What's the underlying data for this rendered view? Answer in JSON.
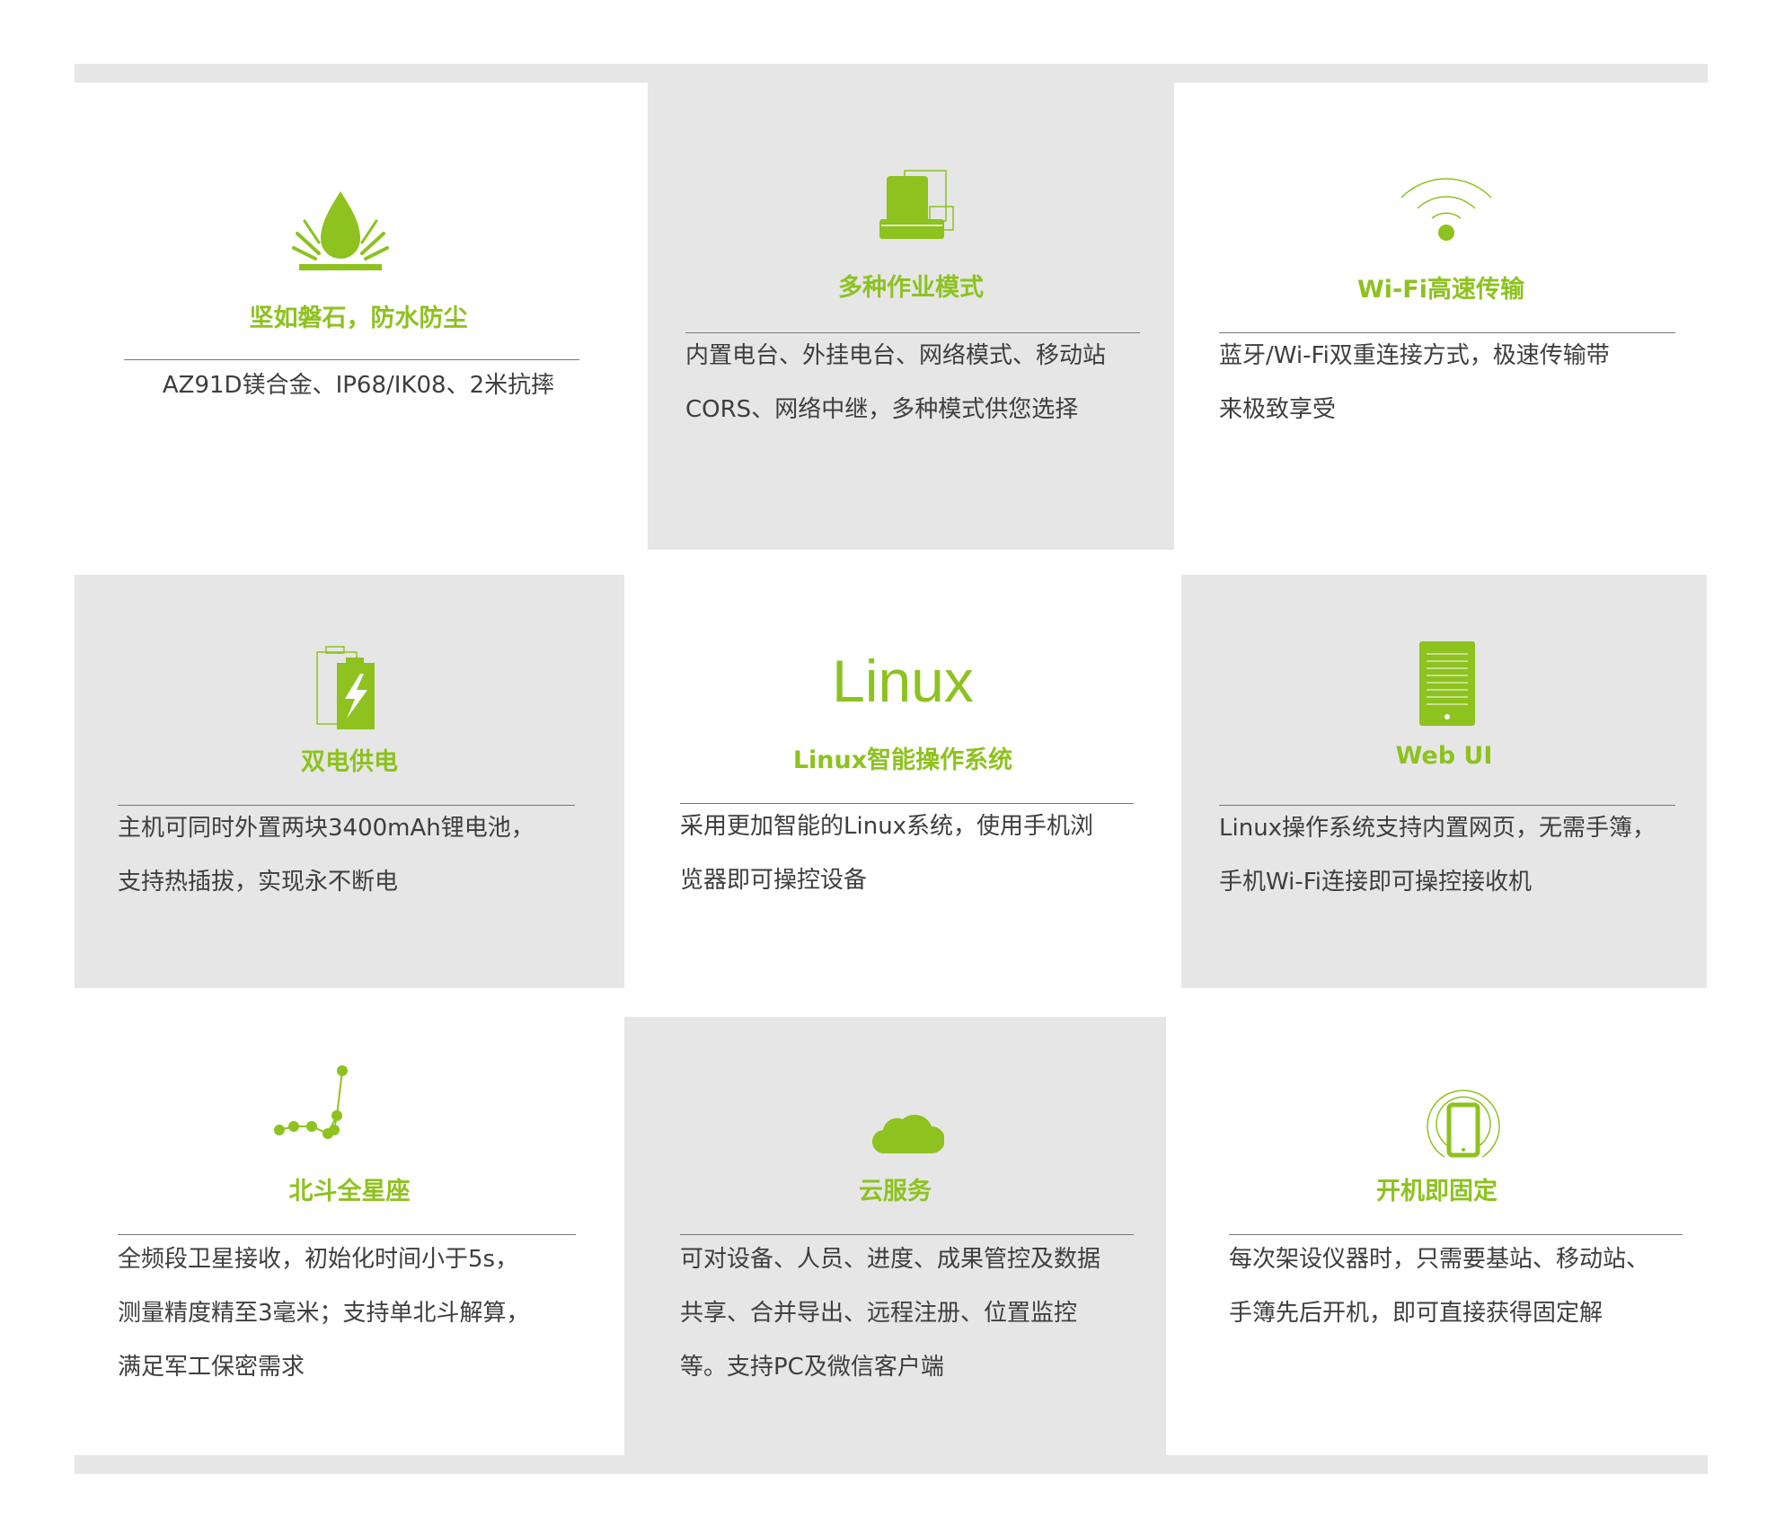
{
  "colors": {
    "accent": "#8dc21f",
    "panel_gray": "#e6e6e6",
    "text": "#3e3e3e",
    "divider": "#777777"
  },
  "features": [
    {
      "icon": "water-drop-icon",
      "title": "坚如磐石，防水防尘",
      "lines": [
        "AZ91D镁合金、IP68/IK08、2米抗摔"
      ]
    },
    {
      "icon": "work-modes-icon",
      "title": "多种作业模式",
      "lines": [
        "内置电台、外挂电台、网络模式、移动站",
        "CORS、网络中继，多种模式供您选择"
      ]
    },
    {
      "icon": "wifi-icon",
      "title": "Wi-Fi高速传输",
      "lines": [
        "蓝牙/Wi-Fi双重连接方式，极速传输带",
        "来极致享受"
      ]
    },
    {
      "icon": "battery-icon",
      "title": "双电供电",
      "lines": [
        "主机可同时外置两块3400mAh锂电池，",
        "支持热插拔，实现永不断电"
      ]
    },
    {
      "icon": "linux-text-icon",
      "big": "Linux",
      "title": "Linux智能操作系统",
      "lines": [
        "采用更加智能的Linux系统，使用手机浏",
        "览器即可操控设备"
      ]
    },
    {
      "icon": "tablet-icon",
      "title": "Web UI",
      "lines": [
        "Linux操作系统支持内置网页，无需手簿，",
        "手机Wi-Fi连接即可操控接收机"
      ]
    },
    {
      "icon": "constellation-icon",
      "title": "北斗全星座",
      "lines": [
        "全频段卫星接收，初始化时间小于5s，",
        "测量精度精至3毫米；支持单北斗解算，",
        "满足军工保密需求"
      ]
    },
    {
      "icon": "cloud-icon",
      "title": "云服务",
      "lines": [
        "可对设备、人员、进度、成果管控及数据",
        "共享、合并导出、远程注册、位置监控",
        "等。支持PC及微信客户端"
      ]
    },
    {
      "icon": "phone-signal-icon",
      "title": "开机即固定",
      "lines": [
        "每次架设仪器时，只需要基站、移动站、",
        "手簿先后开机，即可直接获得固定解"
      ]
    }
  ]
}
